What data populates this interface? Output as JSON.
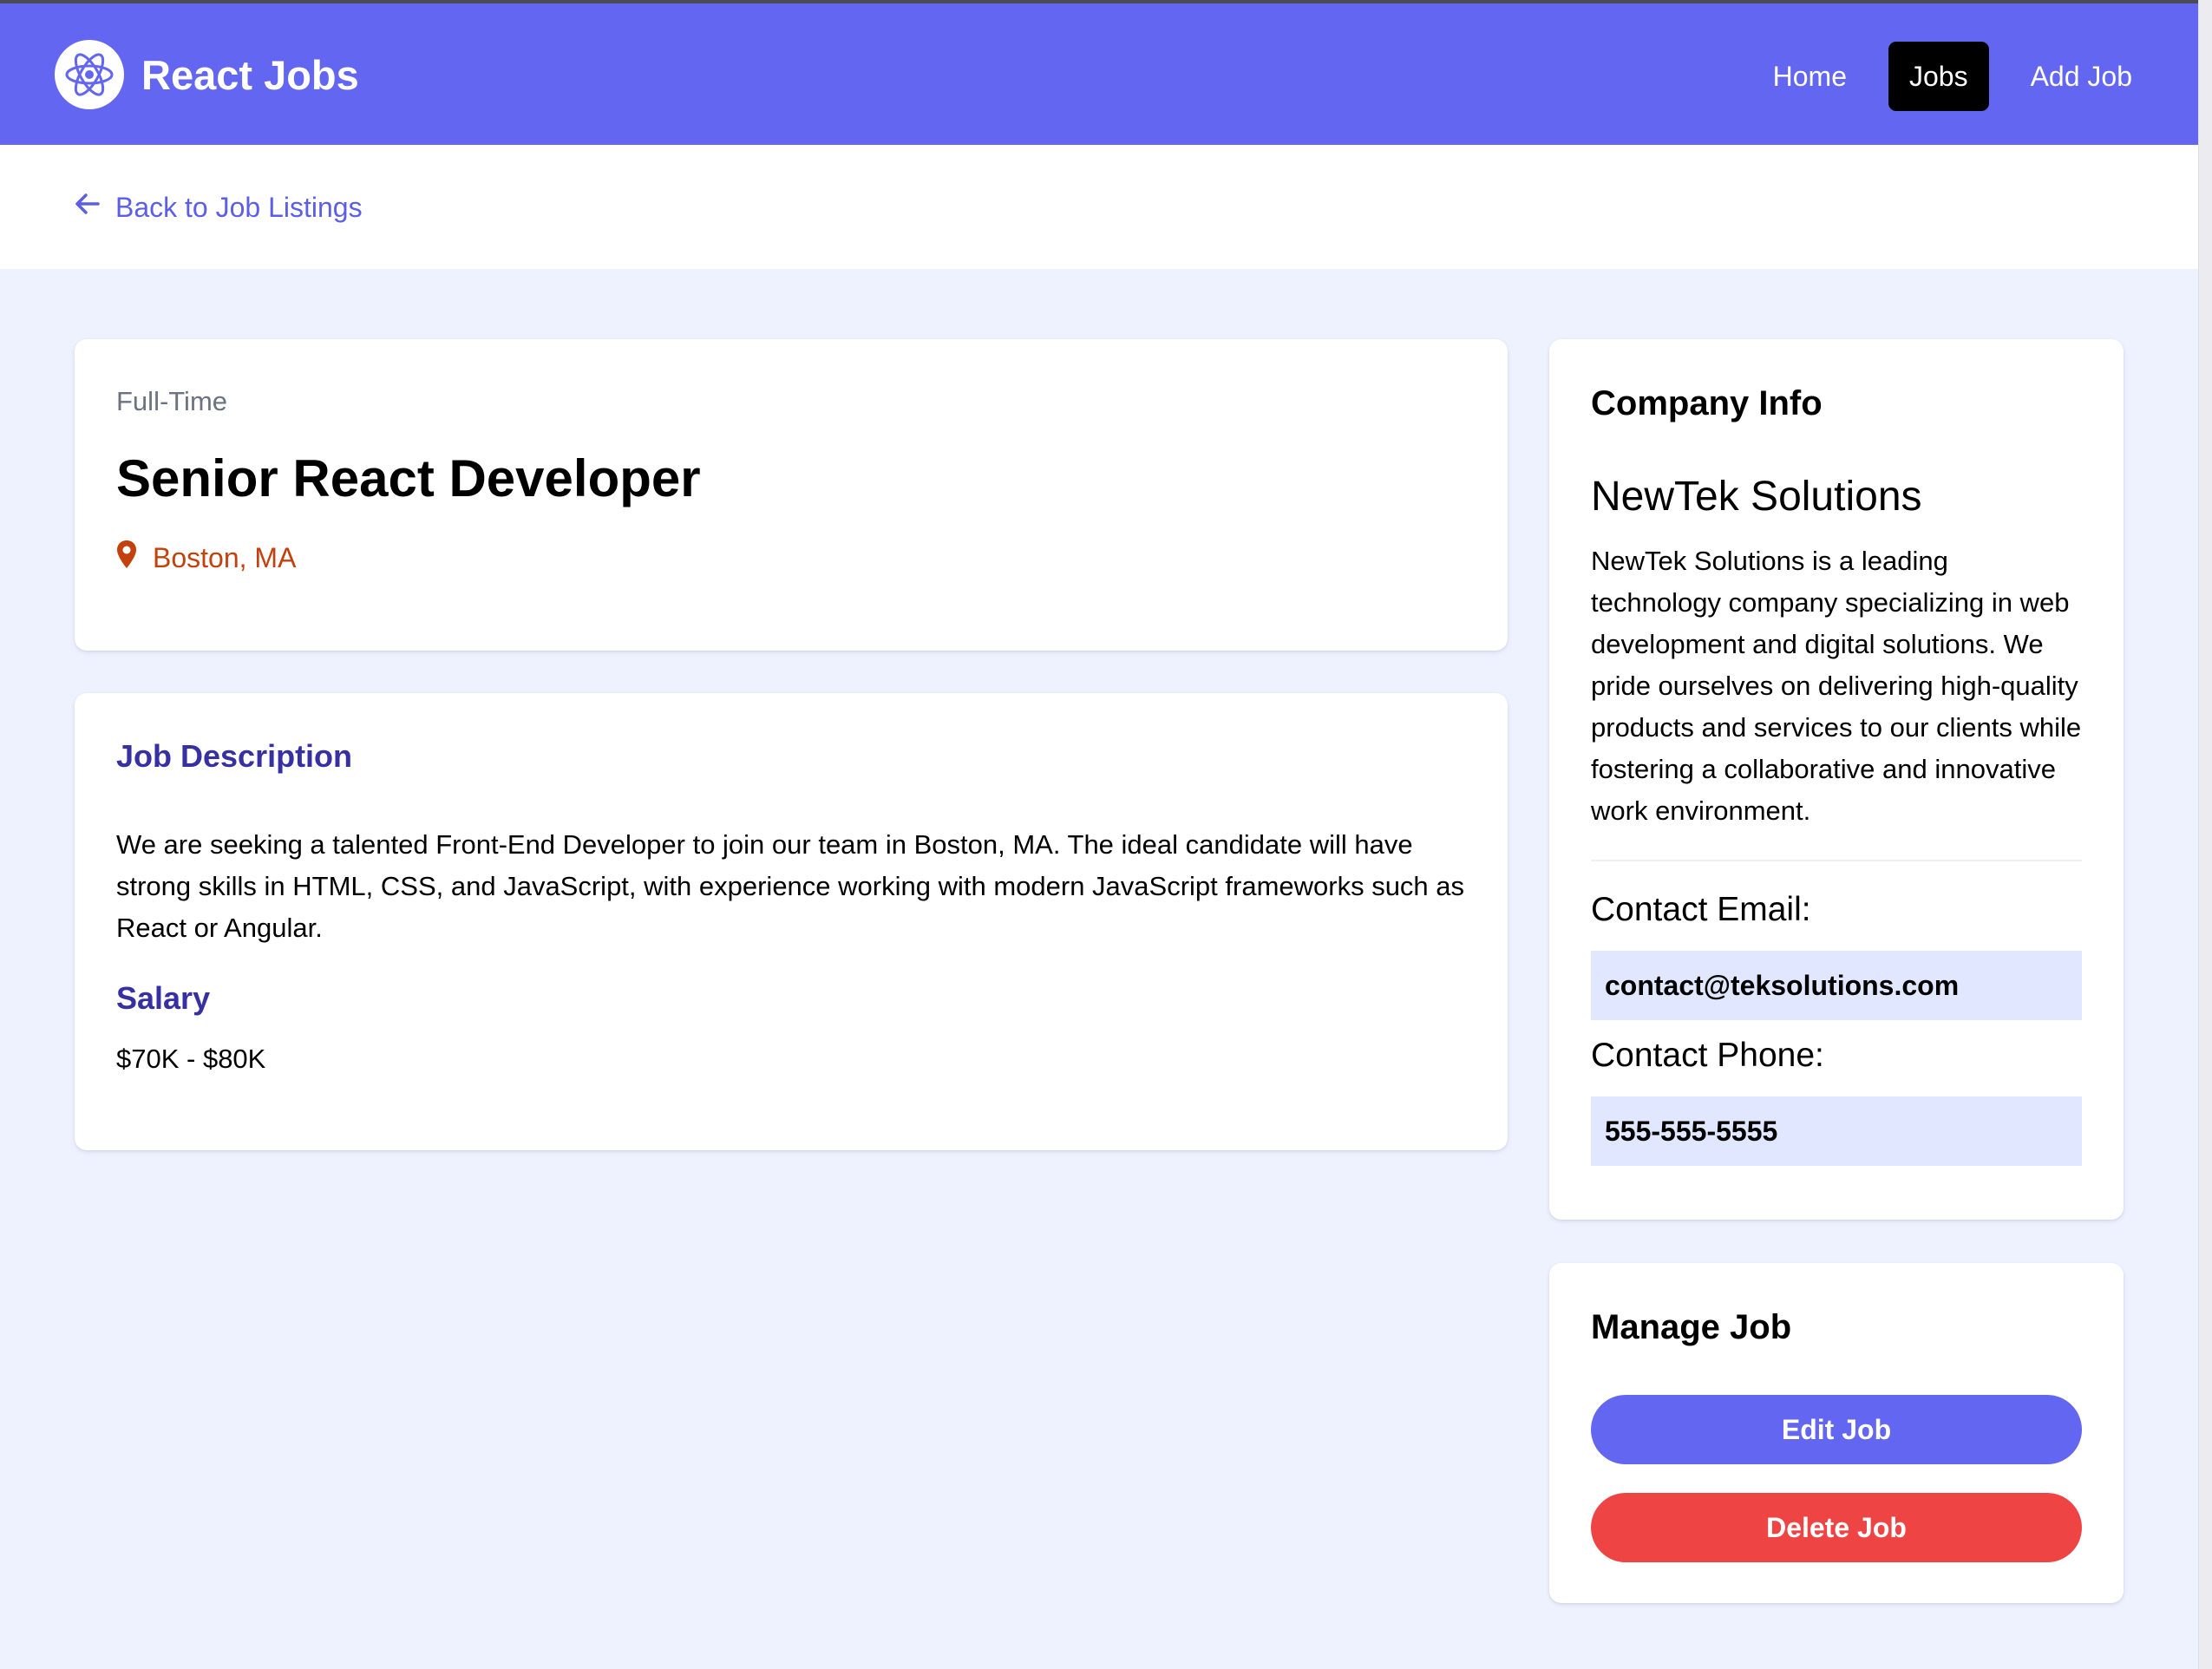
{
  "colors": {
    "brand": "#6366f1",
    "page_background": "#eef2ff",
    "heading_accent": "#3730a3",
    "location": "#c2410c",
    "danger": "#ef4444",
    "contact_box": "#e0e7ff"
  },
  "navbar": {
    "logo_icon": "react-atom-icon",
    "brand": "React Jobs",
    "links": [
      {
        "label": "Home",
        "active": false
      },
      {
        "label": "Jobs",
        "active": true
      },
      {
        "label": "Add Job",
        "active": false
      }
    ]
  },
  "back_link": {
    "icon": "arrow-left-icon",
    "label": "Back to Job Listings"
  },
  "job": {
    "type": "Full-Time",
    "title": "Senior React Developer",
    "location_icon": "map-marker-icon",
    "location": "Boston, MA",
    "description_heading": "Job Description",
    "description": "We are seeking a talented Front-End Developer to join our team in Boston, MA. The ideal candidate will have strong skills in HTML, CSS, and JavaScript, with experience working with modern JavaScript frameworks such as React or Angular.",
    "salary_heading": "Salary",
    "salary": "$70K - $80K"
  },
  "company": {
    "heading": "Company Info",
    "name": "NewTek Solutions",
    "description": "NewTek Solutions is a leading technology company specializing in web development and digital solutions. We pride ourselves on delivering high-quality products and services to our clients while fostering a collaborative and innovative work environment.",
    "email_label": "Contact Email:",
    "email": "contact@teksolutions.com",
    "phone_label": "Contact Phone:",
    "phone": "555-555-5555"
  },
  "manage": {
    "heading": "Manage Job",
    "edit_label": "Edit Job",
    "delete_label": "Delete Job"
  }
}
